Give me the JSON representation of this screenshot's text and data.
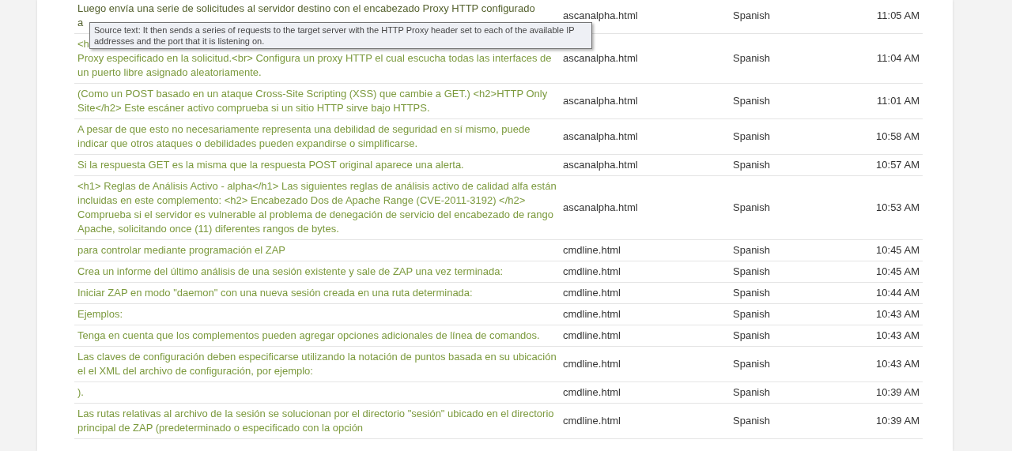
{
  "rows": [
    {
      "source": "Luego envía una serie de solicitudes al servidor destino con el encabezado Proxy HTTP configurado\na",
      "file": "ascanalpha.html",
      "language": "Spanish",
      "time": "11:05 AM",
      "hovered": true
    },
    {
      "source": "<h\nProxy especificado en la solicitud.<br> Configura un proxy HTTP el cual escucha todas las interfaces de un puerto libre asignado aleatoriamente.",
      "file": "ascanalpha.html",
      "language": "Spanish",
      "time": "11:04 AM",
      "hovered": false
    },
    {
      "source": "(Como un POST basado en un ataque Cross-Site Scripting (XSS) que cambie a GET.) <h2>HTTP Only Site</h2> Este escáner activo comprueba si un sitio HTTP sirve bajo HTTPS.",
      "file": "ascanalpha.html",
      "language": "Spanish",
      "time": "11:01 AM",
      "hovered": false
    },
    {
      "source": "A pesar de que esto no necesariamente representa una debilidad de seguridad en sí mismo, puede indicar que otros ataques o debilidades pueden expandirse o simplificarse.",
      "file": "ascanalpha.html",
      "language": "Spanish",
      "time": "10:58 AM",
      "hovered": false
    },
    {
      "source": "Si la respuesta GET es la misma que la respuesta POST original aparece una alerta.",
      "file": "ascanalpha.html",
      "language": "Spanish",
      "time": "10:57 AM",
      "hovered": false
    },
    {
      "source": "<h1> Reglas de Análisis Activo - alpha</h1> Las siguientes reglas de análisis activo de calidad alfa están incluidas en este complemento: <h2> Encabezado Dos de Apache Range (CVE-2011-3192) </h2> Comprueba si el servidor es vulnerable al problema de denegación de servicio del encabezado de rango Apache, solicitando once (11) diferentes rangos de bytes.",
      "file": "ascanalpha.html",
      "language": "Spanish",
      "time": "10:53 AM",
      "hovered": false
    },
    {
      "source": "para controlar mediante programación el ZAP",
      "file": "cmdline.html",
      "language": "Spanish",
      "time": "10:45 AM",
      "hovered": false
    },
    {
      "source": "Crea un informe del último análisis de una sesión existente y sale de ZAP una vez terminada:",
      "file": "cmdline.html",
      "language": "Spanish",
      "time": "10:45 AM",
      "hovered": false
    },
    {
      "source": "Iniciar ZAP en modo \"daemon\" con una nueva sesión creada en una ruta determinada:",
      "file": "cmdline.html",
      "language": "Spanish",
      "time": "10:44 AM",
      "hovered": false
    },
    {
      "source": "Ejemplos:",
      "file": "cmdline.html",
      "language": "Spanish",
      "time": "10:43 AM",
      "hovered": false
    },
    {
      "source": "Tenga en cuenta que los complementos pueden agregar opciones adicionales de línea de comandos.",
      "file": "cmdline.html",
      "language": "Spanish",
      "time": "10:43 AM",
      "hovered": false
    },
    {
      "source": "Las claves de configuración deben especificarse utilizando la notación de puntos basada en su ubicación el el XML del archivo de configuración, por ejemplo:",
      "file": "cmdline.html",
      "language": "Spanish",
      "time": "10:43 AM",
      "hovered": false
    },
    {
      "source": ").",
      "file": "cmdline.html",
      "language": "Spanish",
      "time": "10:39 AM",
      "hovered": false
    },
    {
      "source": "Las rutas relativas al archivo de la sesión se solucionan por el directorio \"sesión\" ubicado en el directorio principal de ZAP (predeterminado o especificado con la opción",
      "file": "cmdline.html",
      "language": "Spanish",
      "time": "10:39 AM",
      "hovered": false
    }
  ],
  "tooltip": {
    "text": "Source text: It then sends a series of requests to the target server with the HTTP Proxy header set to each of the available IP addresses and the port that it is listening on."
  }
}
